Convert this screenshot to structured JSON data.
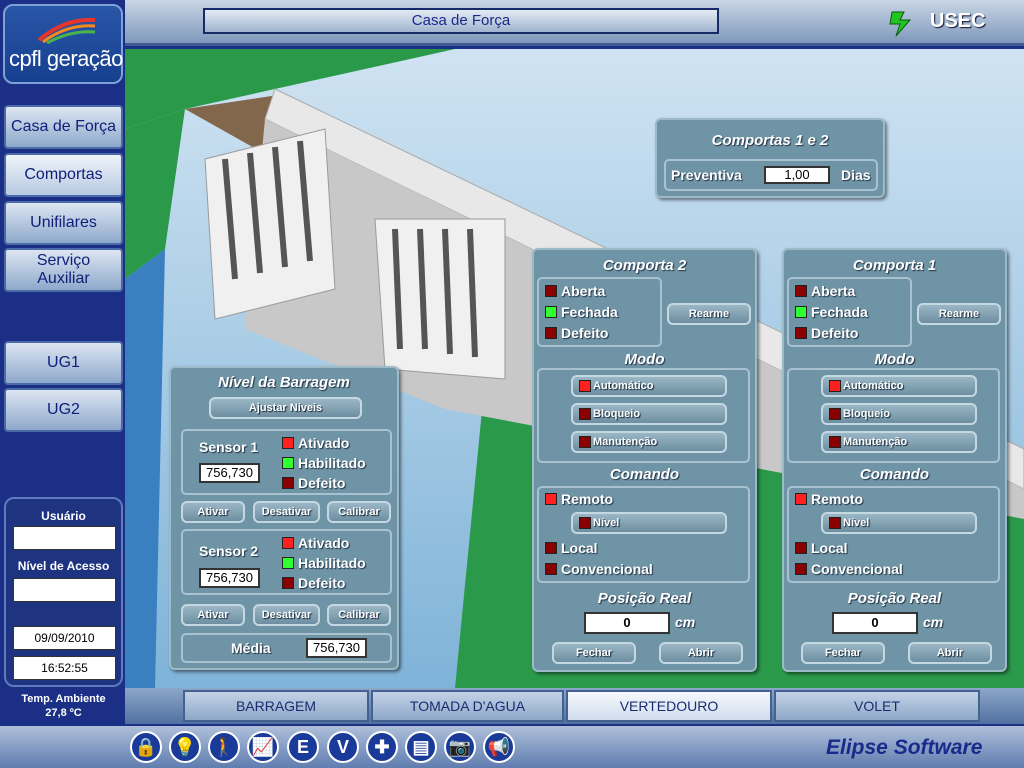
{
  "header": {
    "title": "Casa de Força",
    "user_label": "USEC"
  },
  "logo": {
    "text": "cpfl geração"
  },
  "sidebar": {
    "items": [
      {
        "label": "Casa de Força"
      },
      {
        "label": "Comportas"
      },
      {
        "label": "Unifilares"
      },
      {
        "label": "Serviço\nAuxiliar"
      },
      {
        "label": "UG1"
      },
      {
        "label": "UG2"
      }
    ]
  },
  "user_panel": {
    "user_label": "Usuário",
    "user_value": "",
    "access_label": "Nível de Acesso",
    "access_value": "",
    "date": "09/09/2010",
    "time": "16:52:55"
  },
  "temperature": {
    "label": "Temp. Ambiente",
    "value": "27,8 ºC"
  },
  "comportas12": {
    "title": "Comportas 1 e 2",
    "label": "Preventiva",
    "value": "1,00",
    "unit": "Dias"
  },
  "nivel": {
    "title": "Nível da Barragem",
    "adjust": "Ajustar Níveis",
    "sensor1": {
      "label": "Sensor 1",
      "value": "756,730",
      "ativado": "Ativado",
      "habilitado": "Habilitado",
      "defeito": "Defeito"
    },
    "sensor2": {
      "label": "Sensor 2",
      "value": "756,730",
      "ativado": "Ativado",
      "habilitado": "Habilitado",
      "defeito": "Defeito"
    },
    "buttons": {
      "ativar": "Ativar",
      "desativar": "Desativar",
      "calibrar": "Calibrar"
    },
    "media_label": "Média",
    "media_value": "756,730"
  },
  "comporta2": {
    "title": "Comporta 2",
    "aberta": "Aberta",
    "fechada": "Fechada",
    "defeito": "Defeito",
    "rearme": "Rearme",
    "modo_title": "Modo",
    "automatico": "Automático",
    "bloqueio": "Bloqueio",
    "manutencao": "Manutenção",
    "comando_title": "Comando",
    "remoto": "Remoto",
    "nivel": "Nível",
    "local": "Local",
    "convencional": "Convencional",
    "posicao_title": "Posição Real",
    "posicao_value": "0",
    "posicao_unit": "cm",
    "fechar": "Fechar",
    "abrir": "Abrir"
  },
  "comporta1": {
    "title": "Comporta 1",
    "aberta": "Aberta",
    "fechada": "Fechada",
    "defeito": "Defeito",
    "rearme": "Rearme",
    "modo_title": "Modo",
    "automatico": "Automático",
    "bloqueio": "Bloqueio",
    "manutencao": "Manutenção",
    "comando_title": "Comando",
    "remoto": "Remoto",
    "nivel": "Nível",
    "local": "Local",
    "convencional": "Convencional",
    "posicao_title": "Posição Real",
    "posicao_value": "0",
    "posicao_unit": "cm",
    "fechar": "Fechar",
    "abrir": "Abrir"
  },
  "tabs": [
    {
      "label": "BARRAGEM"
    },
    {
      "label": "TOMADA D'AGUA"
    },
    {
      "label": "VERTEDOURO"
    },
    {
      "label": "VOLET"
    }
  ],
  "toolbar": {
    "icons": [
      "lock-icon",
      "lightbulb-icon",
      "walker-icon",
      "chart-icon",
      "E",
      "V",
      "compass-icon",
      "document-icon",
      "camera-icon",
      "megaphone-icon"
    ]
  },
  "footer": {
    "brand": "Elipse Software"
  },
  "colors": {
    "panel": "#6f94a5",
    "sidebar": "#1b2f86",
    "led_on": "#ff2020",
    "led_ok": "#30ff30",
    "led_off": "#8a0000"
  }
}
